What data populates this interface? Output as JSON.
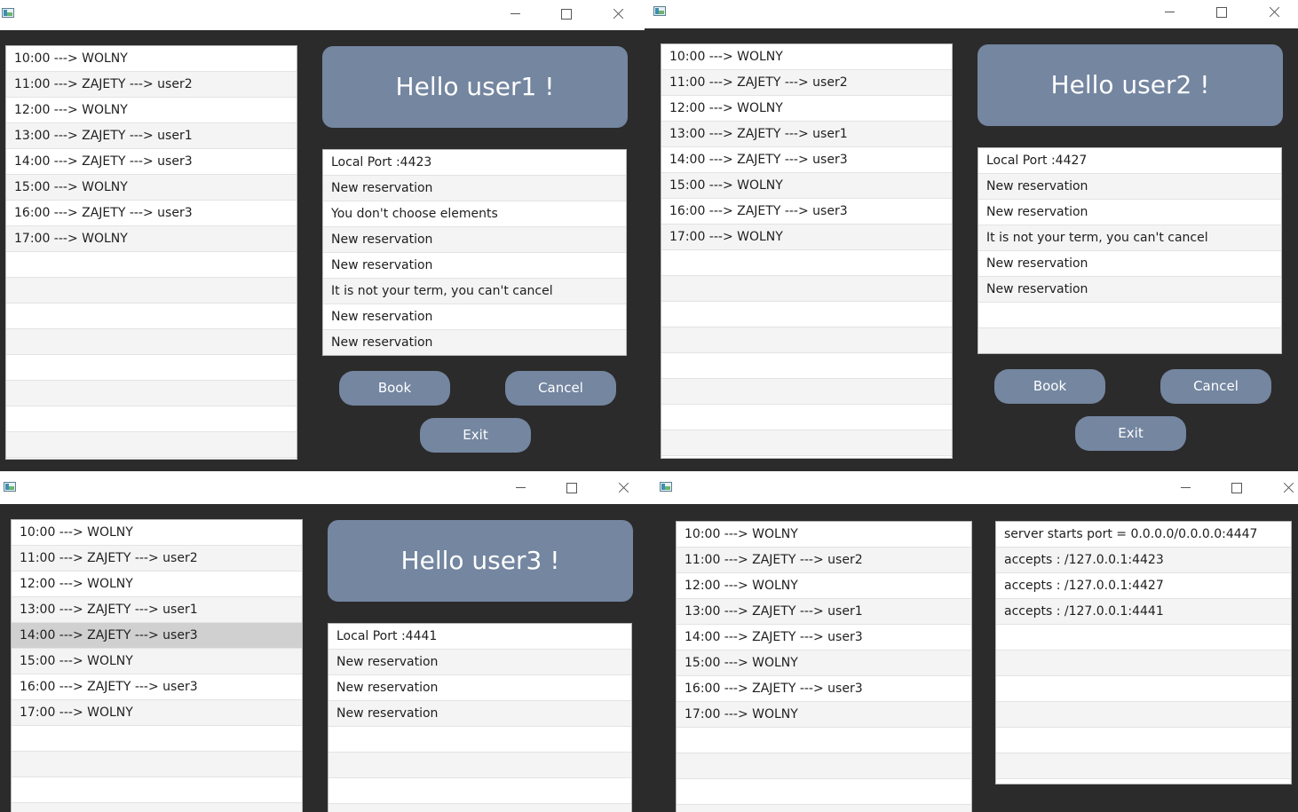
{
  "schedule": [
    "10:00 ---> WOLNY",
    "11:00 ---> ZAJETY ---> user2",
    "12:00 ---> WOLNY",
    "13:00 ---> ZAJETY ---> user1",
    "14:00 ---> ZAJETY ---> user3",
    "15:00 ---> WOLNY",
    "16:00 ---> ZAJETY ---> user3",
    "17:00 ---> WOLNY"
  ],
  "buttons": {
    "book": "Book",
    "cancel": "Cancel",
    "exit": "Exit"
  },
  "windows": {
    "user1": {
      "greeting": "Hello user1 !",
      "log": [
        "Local Port :4423",
        "New reservation",
        "You don't choose elements",
        "New reservation",
        "New reservation",
        "It is not your term, you can't cancel",
        "New reservation",
        "New reservation"
      ]
    },
    "user2": {
      "greeting": "Hello user2 !",
      "log": [
        "Local Port :4427",
        "New reservation",
        "New reservation",
        "It is not your term, you can't cancel",
        "New reservation",
        "New reservation"
      ]
    },
    "user3": {
      "greeting": "Hello user3 !",
      "selected_schedule_row": "14:00 ---> ZAJETY ---> user3",
      "log": [
        "Local Port :4441",
        "New reservation",
        "New reservation",
        "New reservation"
      ]
    },
    "server": {
      "log": [
        "server starts port = 0.0.0.0/0.0.0.0:4447",
        "accepts : /127.0.0.1:4423",
        "accepts : /127.0.0.1:4427",
        "accepts : /127.0.0.1:4441"
      ]
    }
  },
  "colors": {
    "window_background": "#2b2b2b",
    "accent": "#7486a0",
    "selected_row": "#d0d0d0"
  }
}
